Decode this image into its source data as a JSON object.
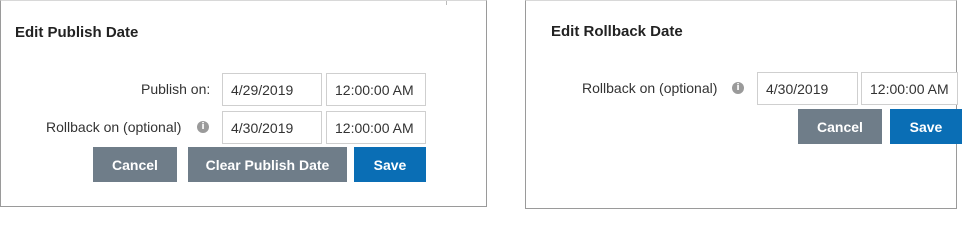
{
  "publish_dialog": {
    "title": "Edit Publish Date",
    "publish_label": "Publish on:",
    "publish_date": "4/29/2019",
    "publish_time": "12:00:00 AM",
    "rollback_label": "Rollback on (optional)",
    "rollback_date": "4/30/2019",
    "rollback_time": "12:00:00 AM",
    "cancel_label": "Cancel",
    "clear_label": "Clear Publish Date",
    "save_label": "Save"
  },
  "rollback_dialog": {
    "title": "Edit Rollback Date",
    "rollback_label": "Rollback on (optional)",
    "rollback_date": "4/30/2019",
    "rollback_time": "12:00:00 AM",
    "cancel_label": "Cancel",
    "save_label": "Save"
  },
  "icons": {
    "info_glyph": "i"
  },
  "colors": {
    "secondary_button": "#6f7d89",
    "primary_button": "#0a6eb5"
  }
}
